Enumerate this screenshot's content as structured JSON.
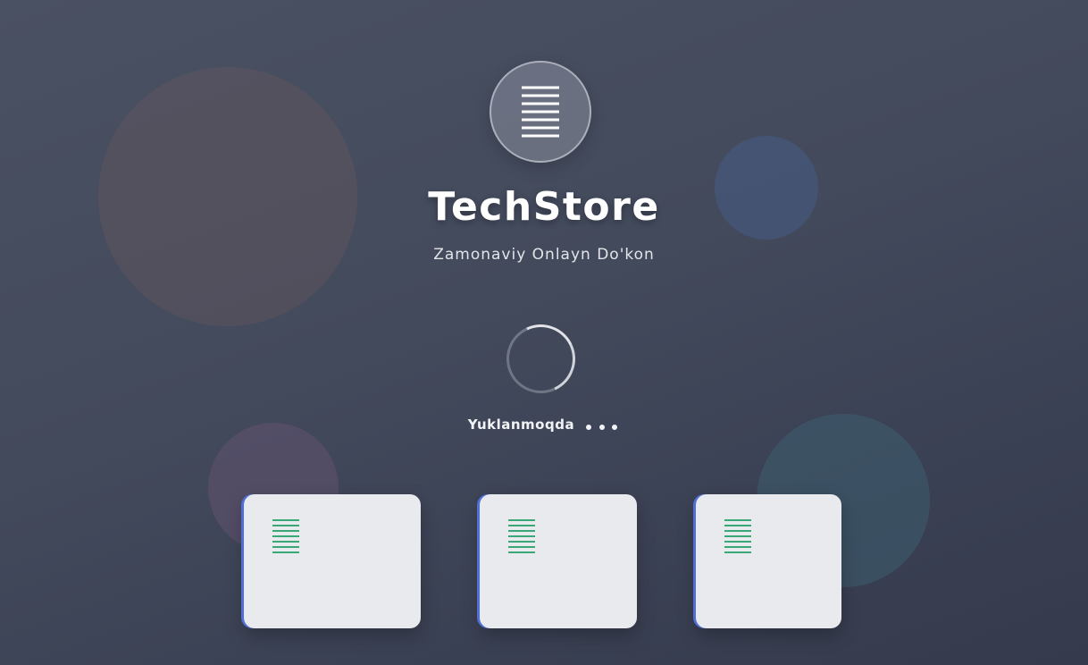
{
  "brand": {
    "title": "TechStore",
    "subtitle": "Zamonaviy Onlayn Do'kon",
    "logo_icon": "menu-lines-icon"
  },
  "loader": {
    "text": "Yuklanmoqda",
    "indicator": "spinner",
    "dots": 3
  },
  "cards": [
    {
      "icon": "menu-lines-icon"
    },
    {
      "icon": "menu-lines-icon"
    },
    {
      "icon": "menu-lines-icon"
    }
  ],
  "colors": {
    "background": "#434a5c",
    "text": "#ffffff",
    "card_background": "#e9eaee",
    "card_accent": "#4f6fd6",
    "card_icon": "#3aa776"
  }
}
